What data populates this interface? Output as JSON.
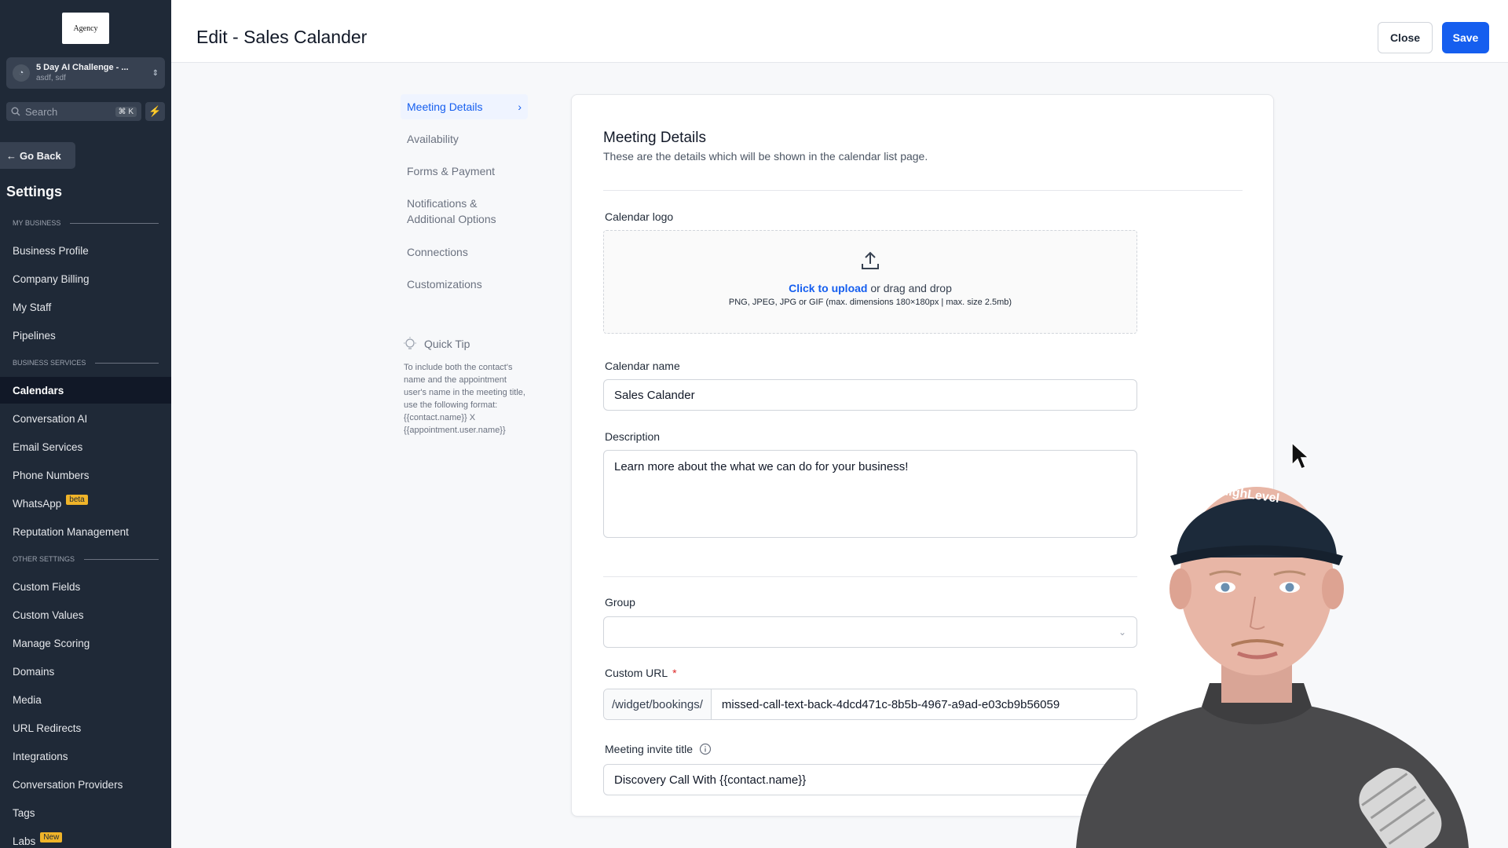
{
  "sidebar": {
    "logo_text": "Agency",
    "account": {
      "name": "5 Day AI Challenge - ...",
      "sub": "asdf, sdf"
    },
    "search": {
      "placeholder": "Search",
      "shortcut": "⌘ K"
    },
    "go_back": "Go Back",
    "settings_title": "Settings",
    "sections": {
      "my_business": "MY BUSINESS",
      "business_services": "BUSINESS SERVICES",
      "other_settings": "OTHER SETTINGS"
    },
    "items": [
      "Business Profile",
      "Company Billing",
      "My Staff",
      "Pipelines",
      "Calendars",
      "Conversation AI",
      "Email Services",
      "Phone Numbers",
      "WhatsApp",
      "Reputation Management",
      "Custom Fields",
      "Custom Values",
      "Manage Scoring",
      "Domains",
      "Media",
      "URL Redirects",
      "Integrations",
      "Conversation Providers",
      "Tags",
      "Labs"
    ],
    "badges": {
      "whatsapp": "beta",
      "labs": "New"
    },
    "active_item": "Calendars"
  },
  "header": {
    "title": "Edit - Sales Calander",
    "close_label": "Close",
    "save_label": "Save"
  },
  "subnav": {
    "items": [
      "Meeting Details",
      "Availability",
      "Forms & Payment",
      "Notifications & Additional Options",
      "Connections",
      "Customizations"
    ],
    "active": "Meeting Details"
  },
  "quick_tip": {
    "title": "Quick Tip",
    "body": "To include both the contact's name and the appointment user's name in the meeting title, use the following format: {{contact.name}} X {{appointment.user.name}}"
  },
  "form": {
    "title": "Meeting Details",
    "subtitle": "These are the details which will be shown in the calendar list page.",
    "logo_label": "Calendar logo",
    "upload_link": "Click to upload",
    "upload_rest": " or drag and drop",
    "upload_hint": "PNG, JPEG, JPG or GIF (max. dimensions 180×180px | max. size 2.5mb)",
    "name_label": "Calendar name",
    "name_value": "Sales Calander",
    "desc_label": "Description",
    "desc_value": "Learn more about the what we can do for your business!",
    "group_label": "Group",
    "group_value": "",
    "url_label": "Custom URL",
    "url_required": "*",
    "url_prefix": "/widget/bookings/",
    "url_value": "missed-call-text-back-4dcd471c-8b5b-4967-a9ad-e03cb9b56059",
    "invite_label": "Meeting invite title",
    "invite_value": "Discovery Call With {{contact.name}}"
  },
  "webcam": {
    "cap_text": "HighLevel"
  },
  "colors": {
    "accent": "#155eef",
    "sidebar_bg": "#1f2937",
    "required": "#dc2626"
  }
}
